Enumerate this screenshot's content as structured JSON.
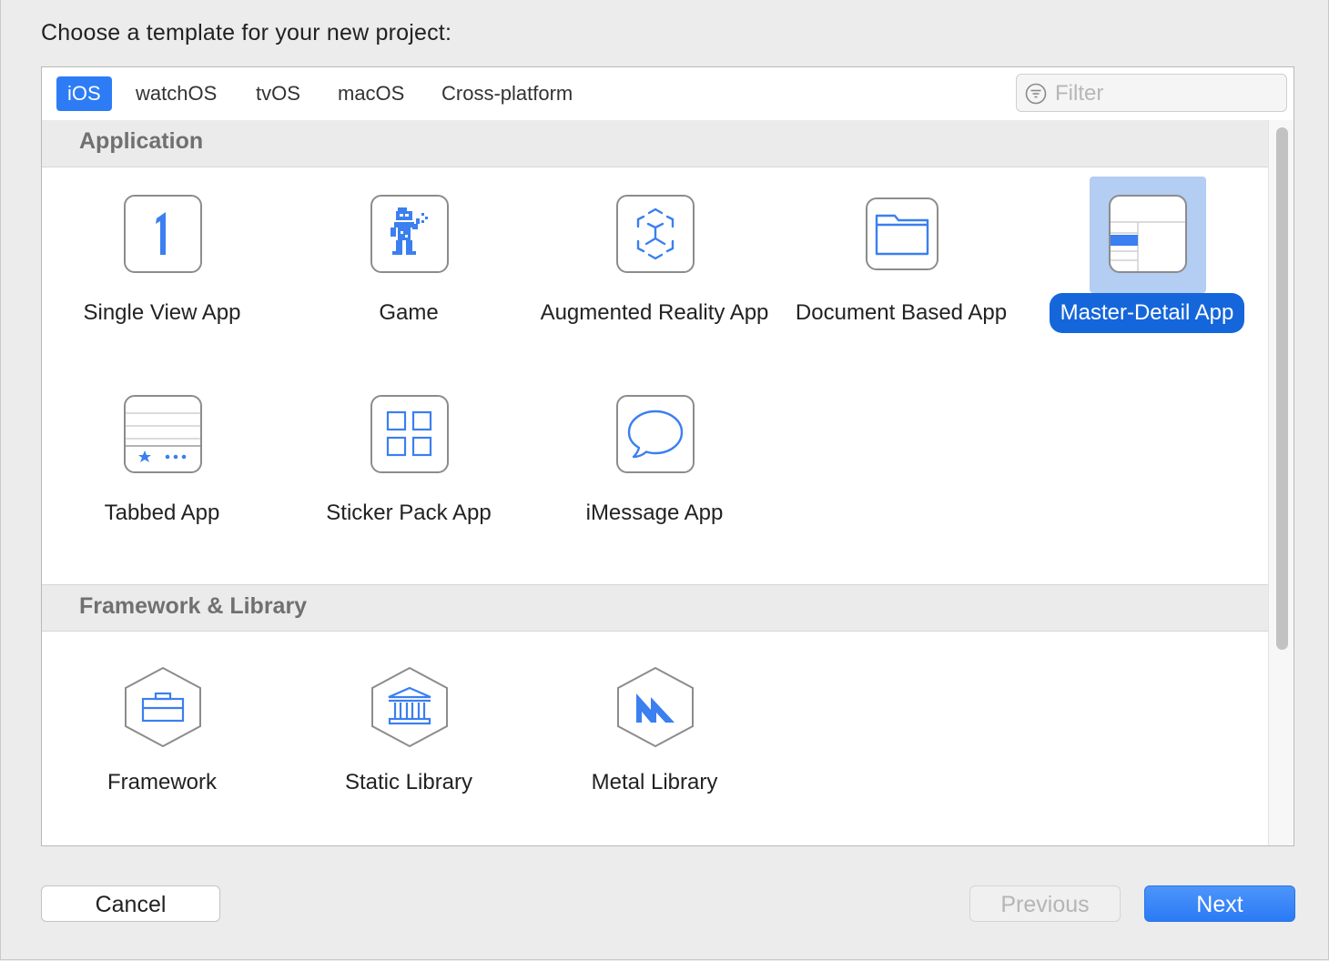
{
  "dialog": {
    "title": "Choose a template for your new project:"
  },
  "tabs": [
    {
      "label": "iOS",
      "active": true
    },
    {
      "label": "watchOS",
      "active": false
    },
    {
      "label": "tvOS",
      "active": false
    },
    {
      "label": "macOS",
      "active": false
    },
    {
      "label": "Cross-platform",
      "active": false
    }
  ],
  "filter": {
    "placeholder": "Filter",
    "value": "",
    "icon": "filter-icon"
  },
  "sections": [
    {
      "title": "Application",
      "templates": [
        {
          "name": "Single View App",
          "icon": "single-view-app-icon",
          "selected": false
        },
        {
          "name": "Game",
          "icon": "game-icon",
          "selected": false
        },
        {
          "name": "Augmented Reality App",
          "icon": "augmented-reality-icon",
          "selected": false
        },
        {
          "name": "Document Based App",
          "icon": "document-folder-icon",
          "selected": false
        },
        {
          "name": "Master-Detail App",
          "icon": "master-detail-icon",
          "selected": true
        },
        {
          "name": "Tabbed App",
          "icon": "tabbed-app-icon",
          "selected": false
        },
        {
          "name": "Sticker Pack App",
          "icon": "sticker-grid-icon",
          "selected": false
        },
        {
          "name": "iMessage App",
          "icon": "speech-bubble-icon",
          "selected": false
        }
      ]
    },
    {
      "title": "Framework & Library",
      "templates": [
        {
          "name": "Framework",
          "icon": "toolbox-hex-icon",
          "selected": false
        },
        {
          "name": "Static Library",
          "icon": "library-building-hex-icon",
          "selected": false
        },
        {
          "name": "Metal Library",
          "icon": "metal-hex-icon",
          "selected": false
        }
      ]
    }
  ],
  "buttons": {
    "cancel": "Cancel",
    "previous": "Previous",
    "next": "Next"
  },
  "colors": {
    "accent": "#2d7cf6",
    "selection_bg": "#b3cdf3",
    "selection_label": "#1566db",
    "icon_blue": "#3b7ff0"
  }
}
